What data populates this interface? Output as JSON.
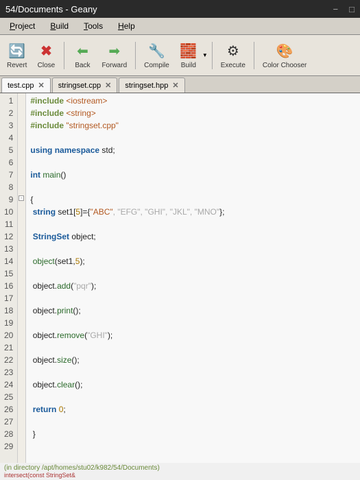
{
  "window": {
    "title": "54/Documents - Geany",
    "min": "−",
    "max": "□",
    "close": "✕"
  },
  "menus": {
    "project": "Project",
    "build": "Build",
    "tools": "Tools",
    "help": "Help"
  },
  "toolbar": {
    "revert": "Revert",
    "close": "Close",
    "back": "Back",
    "forward": "Forward",
    "compile": "Compile",
    "build": "Build",
    "execute": "Execute",
    "color": "Color Chooser"
  },
  "tabs": [
    {
      "label": "test.cpp",
      "active": true
    },
    {
      "label": "stringset.cpp",
      "active": false
    },
    {
      "label": "stringset.hpp",
      "active": false
    }
  ],
  "editor": {
    "line_count": 29,
    "fold_at": 9,
    "lines": [
      {
        "n": 1,
        "tokens": [
          [
            "preproc",
            "#include"
          ],
          [
            "text",
            " "
          ],
          [
            "header",
            "<iostream>"
          ]
        ]
      },
      {
        "n": 2,
        "tokens": [
          [
            "preproc",
            "#include"
          ],
          [
            "text",
            " "
          ],
          [
            "header",
            "<string>"
          ]
        ]
      },
      {
        "n": 3,
        "tokens": [
          [
            "preproc",
            "#include"
          ],
          [
            "text",
            " "
          ],
          [
            "string",
            "\"stringset.cpp\""
          ]
        ]
      },
      {
        "n": 4,
        "tokens": []
      },
      {
        "n": 5,
        "tokens": [
          [
            "blue",
            "using namespace"
          ],
          [
            "text",
            " std;"
          ]
        ]
      },
      {
        "n": 6,
        "tokens": []
      },
      {
        "n": 7,
        "tokens": [
          [
            "blue",
            "int"
          ],
          [
            "text",
            " "
          ],
          [
            "ident",
            "main"
          ],
          [
            "text",
            "()"
          ]
        ]
      },
      {
        "n": 8,
        "tokens": []
      },
      {
        "n": 9,
        "tokens": [
          [
            "text",
            "{"
          ]
        ]
      },
      {
        "n": 10,
        "tokens": [
          [
            "text",
            " "
          ],
          [
            "blue",
            "string"
          ],
          [
            "text",
            " set1["
          ],
          [
            "num",
            "5"
          ],
          [
            "text",
            "]={"
          ],
          [
            "string",
            "\"ABC\""
          ],
          [
            "faded",
            ", \"EFG\", \"GHI\", \"JKL\", \"MNO\""
          ],
          [
            "text",
            "};"
          ]
        ]
      },
      {
        "n": 11,
        "tokens": []
      },
      {
        "n": 12,
        "tokens": [
          [
            "text",
            " "
          ],
          [
            "blue",
            "StringSet"
          ],
          [
            "text",
            " object;"
          ]
        ]
      },
      {
        "n": 13,
        "tokens": []
      },
      {
        "n": 14,
        "tokens": [
          [
            "text",
            " "
          ],
          [
            "ident",
            "object"
          ],
          [
            "text",
            "(set1,"
          ],
          [
            "num",
            "5"
          ],
          [
            "text",
            ");"
          ]
        ]
      },
      {
        "n": 15,
        "tokens": []
      },
      {
        "n": 16,
        "tokens": [
          [
            "text",
            " object."
          ],
          [
            "ident",
            "add"
          ],
          [
            "text",
            "("
          ],
          [
            "faded",
            "\"pqr\""
          ],
          [
            "text",
            ");"
          ]
        ]
      },
      {
        "n": 17,
        "tokens": []
      },
      {
        "n": 18,
        "tokens": [
          [
            "text",
            " object."
          ],
          [
            "ident",
            "print"
          ],
          [
            "text",
            "();"
          ]
        ]
      },
      {
        "n": 19,
        "tokens": []
      },
      {
        "n": 20,
        "tokens": [
          [
            "text",
            " object."
          ],
          [
            "ident",
            "remove"
          ],
          [
            "text",
            "("
          ],
          [
            "faded",
            "\"GHI\""
          ],
          [
            "text",
            ");"
          ]
        ]
      },
      {
        "n": 21,
        "tokens": []
      },
      {
        "n": 22,
        "tokens": [
          [
            "text",
            " object."
          ],
          [
            "ident",
            "size"
          ],
          [
            "text",
            "();"
          ]
        ]
      },
      {
        "n": 23,
        "tokens": []
      },
      {
        "n": 24,
        "tokens": [
          [
            "text",
            " object."
          ],
          [
            "ident",
            "clear"
          ],
          [
            "text",
            "();"
          ]
        ]
      },
      {
        "n": 25,
        "tokens": []
      },
      {
        "n": 26,
        "tokens": [
          [
            "text",
            " "
          ],
          [
            "blue",
            "return"
          ],
          [
            "text",
            " "
          ],
          [
            "num",
            "0"
          ],
          [
            "text",
            ";"
          ]
        ]
      },
      {
        "n": 27,
        "tokens": []
      },
      {
        "n": 28,
        "tokens": [
          [
            "text",
            " }"
          ]
        ]
      },
      {
        "n": 29,
        "tokens": []
      }
    ]
  },
  "status": {
    "dir": "(in directory /apt/homes/stu02/k982/54/Documents)",
    "err": "intersect(const StringSet&"
  }
}
